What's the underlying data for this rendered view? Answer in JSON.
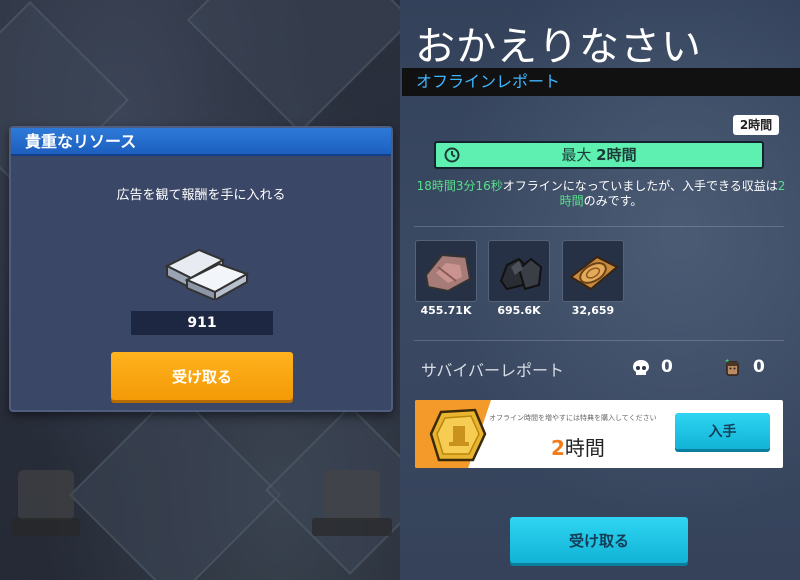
{
  "resource_panel": {
    "title": "貴重なリソース",
    "description": "広告を観て報酬を手に入れる",
    "amount": "911",
    "claim_label": "受け取る",
    "icon": "silver-ingot-icon"
  },
  "offline_report": {
    "welcome": "おかえりなさい",
    "section_label": "オフラインレポート",
    "hours_tag": "2時間",
    "max_prefix": "最大",
    "max_value": "2時間",
    "offline_duration": "18時間3分16秒",
    "message_mid": "オフラインになっていましたが、入手できる収益は",
    "message_hours": "2時間",
    "message_end": "のみです。",
    "resources": [
      {
        "icon": "meat-icon",
        "value": "455.71K"
      },
      {
        "icon": "coal-icon",
        "value": "695.6K"
      },
      {
        "icon": "wood-log-icon",
        "value": "32,659"
      }
    ],
    "survivor_label": "サバイバーレポート",
    "deaths": "0",
    "survivors": "0",
    "offer": {
      "subtitle": "オフライン時間を増やすには特典を購入してください",
      "hours_num": "2",
      "hours_unit": "時間",
      "button_label": "入手"
    },
    "claim_label": "受け取る"
  },
  "colors": {
    "accent_blue": "#3fb6ff",
    "max_bar": "#5ef0b0",
    "orange_button": "#f39a07",
    "cyan_button": "#12b3d6"
  }
}
